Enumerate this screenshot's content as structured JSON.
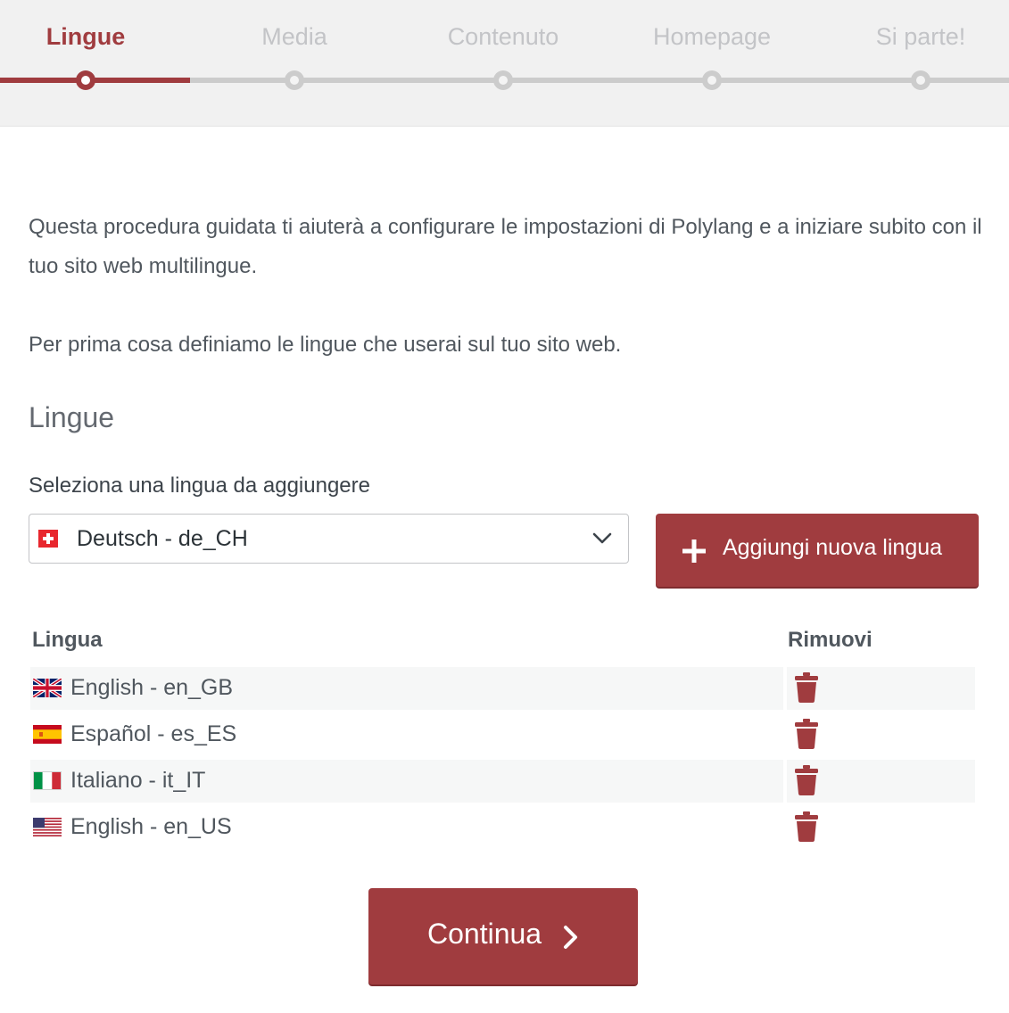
{
  "steps": {
    "items": [
      {
        "label": "Lingue",
        "active": true
      },
      {
        "label": "Media",
        "active": false
      },
      {
        "label": "Contenuto",
        "active": false
      },
      {
        "label": "Homepage",
        "active": false
      },
      {
        "label": "Si parte!",
        "active": false
      }
    ]
  },
  "intro": {
    "paragraph1": "Questa procedura guidata ti aiuterà a configurare le impostazioni di Polylang e a iniziare subito con il tuo sito web multilingue.",
    "paragraph2": "Per prima cosa definiamo le lingue che userai sul tuo sito web."
  },
  "languages_section": {
    "title": "Lingue",
    "select_label": "Seleziona una lingua da aggiungere",
    "selected_language": "Deutsch - de_CH",
    "selected_flag": "switzerland-flag-icon",
    "add_button_label": "Aggiungi nuova lingua"
  },
  "table": {
    "headers": {
      "language": "Lingua",
      "remove": "Rimuovi"
    },
    "rows": [
      {
        "name": "English - en_GB",
        "flag": "uk-flag-icon"
      },
      {
        "name": "Español - es_ES",
        "flag": "spain-flag-icon"
      },
      {
        "name": "Italiano - it_IT",
        "flag": "italy-flag-icon"
      },
      {
        "name": "English - en_US",
        "flag": "us-flag-icon"
      }
    ]
  },
  "continue_button_label": "Continua",
  "colors": {
    "accent": "#a03c3f",
    "step_inactive": "#cccccc",
    "header_bg": "#f1f1f1",
    "row_shade": "#f6f7f7"
  }
}
